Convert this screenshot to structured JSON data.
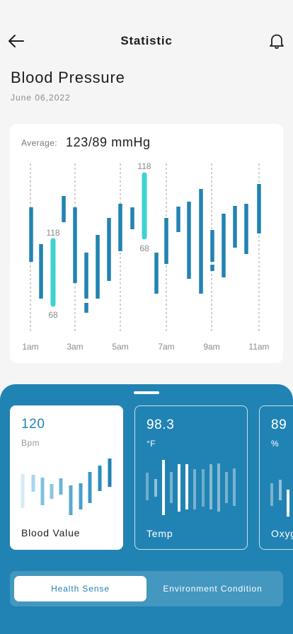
{
  "header": {
    "title": "Statistic",
    "back_icon": "arrow-left-icon",
    "bell_icon": "bell-icon"
  },
  "page": {
    "heading": "Blood Pressure",
    "date": "June 06,2022"
  },
  "chart_card": {
    "average_label": "Average:",
    "average_value": "123/89 mmHg"
  },
  "chart_data": {
    "type": "bar",
    "title": "",
    "xlabel": "",
    "ylabel": "",
    "x_ticks": [
      "1am",
      "3am",
      "5am",
      "7am",
      "9am",
      "11am"
    ],
    "highlight_labels": [
      {
        "high": "118",
        "low": "68"
      },
      {
        "high": "118",
        "low": "68"
      }
    ],
    "colors": {
      "default": "#2183b3",
      "highlight": "#3dd3d0",
      "gridline": "#8a8a8a"
    }
  },
  "cards": [
    {
      "value": "120",
      "unit": "Bpm",
      "name": "Blood Value",
      "active": true
    },
    {
      "value": "98.3",
      "unit": "°F",
      "name": "Temp",
      "active": false
    },
    {
      "value": "89",
      "unit": "%",
      "name": "Oxyg",
      "active": false
    }
  ],
  "segment": {
    "options": [
      "Health Sense",
      "Environment Condition"
    ],
    "selected": "Health Sense"
  },
  "colors": {
    "primary": "#2183b3",
    "accent": "#3dd3d0",
    "background": "#f5f5f5"
  }
}
